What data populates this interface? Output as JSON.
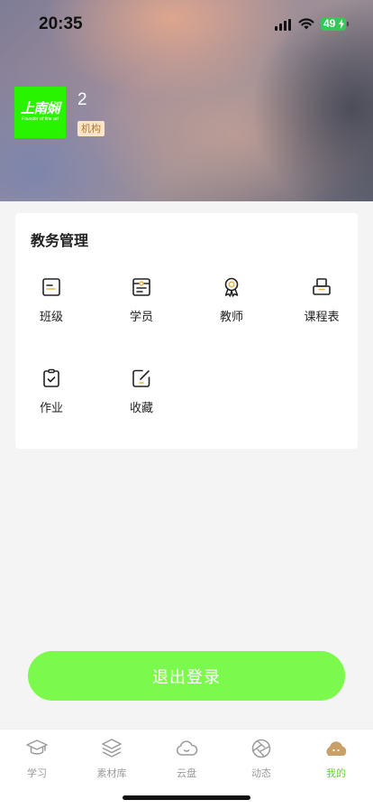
{
  "status_bar": {
    "time": "20:35",
    "battery": "49"
  },
  "profile": {
    "logo_text": "上南娴",
    "logo_subtext": "Founder of fine art",
    "name": "2",
    "role": "机构"
  },
  "academic_card": {
    "title": "教务管理",
    "items": [
      {
        "label": "班级",
        "icon": "class-icon"
      },
      {
        "label": "学员",
        "icon": "student-icon"
      },
      {
        "label": "教师",
        "icon": "teacher-icon"
      },
      {
        "label": "课程表",
        "icon": "schedule-icon"
      },
      {
        "label": "作业",
        "icon": "homework-icon"
      },
      {
        "label": "收藏",
        "icon": "favorite-icon"
      }
    ]
  },
  "logout_label": "退出登录",
  "tabbar": {
    "items": [
      {
        "label": "学习",
        "icon": "graduation-cap-icon"
      },
      {
        "label": "素材库",
        "icon": "layers-icon"
      },
      {
        "label": "云盘",
        "icon": "cloud-icon"
      },
      {
        "label": "动态",
        "icon": "aperture-icon"
      },
      {
        "label": "我的",
        "icon": "profile-icon"
      }
    ],
    "active_index": 4
  },
  "colors": {
    "accent_green": "#7cf94d",
    "active_tab": "#6bd23a",
    "badge_bg": "#fbe5c6",
    "badge_text": "#b07a3a",
    "logo_bg": "#29f400",
    "active_tab_icon": "#c9a06a"
  }
}
